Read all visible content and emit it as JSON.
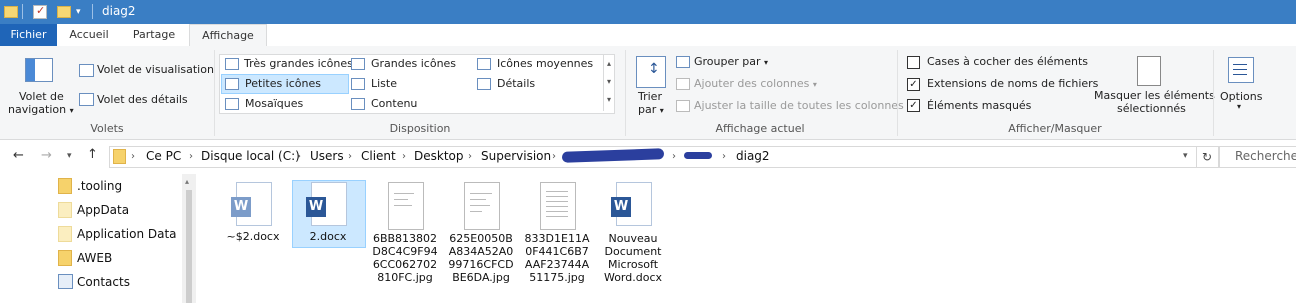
{
  "window": {
    "title": "diag2"
  },
  "tabs": {
    "fichier": "Fichier",
    "accueil": "Accueil",
    "partage": "Partage",
    "affichage": "Affichage"
  },
  "ribbon": {
    "volets": {
      "volet_navigation_line1": "Volet de",
      "volet_navigation_line2": "navigation",
      "volet_visualisation": "Volet de visualisation",
      "volet_details": "Volet des détails",
      "group_label": "Volets"
    },
    "disposition": {
      "tres_grandes_icones": "Très grandes icônes",
      "grandes_icones": "Grandes icônes",
      "icones_moyennes": "Icônes moyennes",
      "petites_icones": "Petites icônes",
      "liste": "Liste",
      "details": "Détails",
      "mosaiques": "Mosaïques",
      "contenu": "Contenu",
      "group_label": "Disposition"
    },
    "affichage_actuel": {
      "trier_line1": "Trier",
      "trier_line2": "par",
      "grouper_par": "Grouper par",
      "ajouter_colonnes": "Ajouter des colonnes",
      "ajuster_taille": "Ajuster la taille de toutes les colonnes",
      "group_label": "Affichage actuel"
    },
    "afficher_masquer": {
      "cases_a_cocher": "Cases à cocher des éléments",
      "cases_a_cocher_checked": false,
      "extensions": "Extensions de noms de fichiers",
      "extensions_checked": true,
      "elements_masques": "Éléments masqués",
      "elements_masques_checked": true,
      "masquer_line1": "Masquer les éléments",
      "masquer_line2": "sélectionnés",
      "group_label": "Afficher/Masquer"
    },
    "options": {
      "label": "Options"
    }
  },
  "address": {
    "crumbs": [
      "Ce PC",
      "Disque local (C:)",
      "Users",
      "Client",
      "Desktop",
      "Supervision",
      "diag2"
    ],
    "search_placeholder": "Rechercher"
  },
  "nav": {
    "items": [
      ".tooling",
      "AppData",
      "Application Data",
      "AWEB",
      "Contacts"
    ]
  },
  "files": [
    {
      "lines": [
        "~$2.docx"
      ],
      "icon": "word-temp"
    },
    {
      "lines": [
        "2.docx"
      ],
      "icon": "word",
      "selected": true
    },
    {
      "lines": [
        "6BB813802",
        "D8C4C9F94",
        "6CC062702",
        "810FC.jpg"
      ],
      "icon": "image"
    },
    {
      "lines": [
        "625E0050B",
        "A834A52A0",
        "99716CFCD",
        "BE6DA.jpg"
      ],
      "icon": "image"
    },
    {
      "lines": [
        "833D1E11A",
        "0F441C6B7",
        "AAF23744A",
        "51175.jpg"
      ],
      "icon": "image"
    },
    {
      "lines": [
        "Nouveau",
        "Document",
        "Microsoft",
        "Word.docx"
      ],
      "icon": "word"
    }
  ],
  "colors": {
    "titlebar": "#3a7ec4",
    "fichier_tab": "#1f65b8",
    "ribbon_bg": "#f5f6f7",
    "selection": "#cce8ff",
    "redaction": "#2b3f9e"
  }
}
